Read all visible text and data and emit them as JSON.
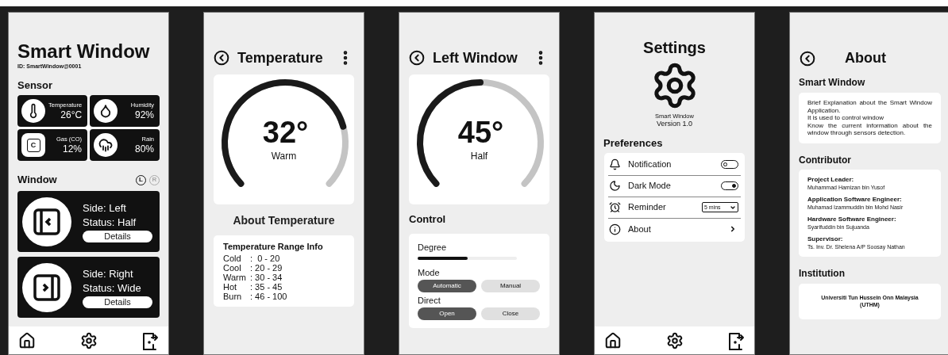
{
  "home": {
    "title": "Smart Window",
    "id_text": "ID: SmartWindow@0001",
    "sensor_heading": "Sensor",
    "sensors": [
      {
        "label": "Temperature",
        "value": "26°C"
      },
      {
        "label": "Humidity",
        "value": "92%"
      },
      {
        "label": "Gas (CO)",
        "value": "12%",
        "badge": "C"
      },
      {
        "label": "Rain",
        "value": "80%"
      }
    ],
    "window_heading": "Window",
    "side_toggles": [
      {
        "label": "L",
        "selected": true
      },
      {
        "label": "R",
        "selected": false
      }
    ],
    "windows": [
      {
        "side": "Side: Left",
        "status": "Status: Half",
        "button": "Details",
        "kind": "left"
      },
      {
        "side": "Side: Right",
        "status": "Status: Wide",
        "button": "Details",
        "kind": "right"
      }
    ]
  },
  "sensor_page": {
    "title": "Temperature",
    "gauge": {
      "value": "32°",
      "label": "Warm"
    },
    "about_heading": "About Temperature",
    "info": {
      "heading": "Temperature Range Info",
      "rows": [
        {
          "name": "Cold",
          "range": ":  0 - 20"
        },
        {
          "name": "Cool",
          "range": ": 20 - 29"
        },
        {
          "name": "Warm",
          "range": ": 30 - 34"
        },
        {
          "name": "Hot",
          "range": ": 35 - 45"
        },
        {
          "name": "Burn",
          "range": ": 46 - 100"
        }
      ]
    }
  },
  "window_page": {
    "title": "Left Window",
    "gauge": {
      "value": "45°",
      "label": "Half"
    },
    "control_heading": "Control",
    "degree": {
      "label": "Degree",
      "level": 0.5
    },
    "groups": [
      {
        "label": "Mode",
        "options": [
          {
            "label": "Automatic",
            "selected": true
          },
          {
            "label": "Manual",
            "selected": false
          }
        ]
      },
      {
        "label": "Direct",
        "options": [
          {
            "label": "Open",
            "selected": true
          },
          {
            "label": "Close",
            "selected": false
          }
        ]
      }
    ]
  },
  "settings_page": {
    "title": "Settings",
    "app_name": "Smart Window",
    "version": "Version 1.0",
    "pref_heading": "Preferences",
    "items": [
      {
        "kind": "toggle",
        "label": "Notification",
        "on": false
      },
      {
        "kind": "toggle",
        "label": "Dark Mode",
        "on": true
      },
      {
        "kind": "select",
        "label": "Reminder",
        "value": "5 mins"
      },
      {
        "kind": "link",
        "label": "About"
      }
    ]
  },
  "about_page": {
    "title": "About",
    "app_heading": "Smart Window",
    "description": "Brief Explanation about the Smart Window Application.\nIt is used to control window\nKnow the current information about the window through sensors detection.",
    "contributor_heading": "Contributor",
    "contributors": [
      {
        "role": "Project Leader:",
        "name": "Muhammad Hamizan bin Yusof"
      },
      {
        "role": "Application Software Engineer:",
        "name": "Muhamad Izammuddin bin Mohd Nasir"
      },
      {
        "role": "Hardware Software Engineer:",
        "name": "Syarifuddin bin Sujuanda"
      },
      {
        "role": "Supervisor:",
        "name": "Ts. Inv. Dr. Shelena A/P Soosay Nathan"
      }
    ],
    "institution_heading": "Institution",
    "institution": "Universiti Tun Hussein Onn Malaysia\n(UTHM)"
  }
}
